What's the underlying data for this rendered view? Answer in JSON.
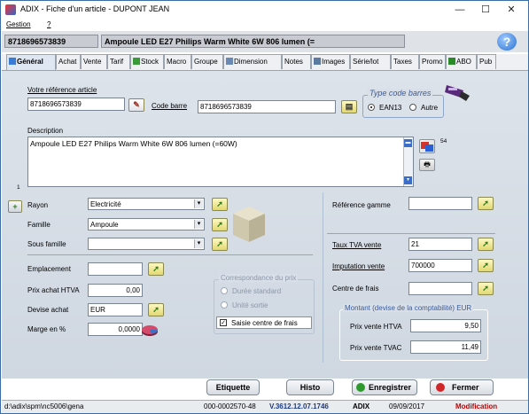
{
  "window": {
    "title": "ADIX - Fiche d'un article - DUPONT JEAN"
  },
  "menu": {
    "items": [
      "Gestion",
      "?"
    ]
  },
  "header": {
    "code": "8718696573839",
    "name": "Ampoule LED E27 Philips Warm White 6W 806 lumen (="
  },
  "tabs": [
    "Général",
    "Achat",
    "Vente",
    "Tarif",
    "Stock",
    "Macro",
    "Groupe",
    "Dimension",
    "Notes",
    "Images",
    "Série/lot",
    "Taxes",
    "Promo",
    "ABO",
    "Pub"
  ],
  "form": {
    "ref_label": "Votre référence article",
    "ref_value": "8718696573839",
    "barcode_label": "Code barre",
    "barcode_value": "8718696573839",
    "barcode_type_title": "Type code barres",
    "ean13_label": "EAN13",
    "autre_label": "Autre",
    "description_label": "Description",
    "description_value": "Ampoule LED E27 Philips Warm White 6W 806 lumen (=60W)",
    "description_count": "54",
    "side_num": "1",
    "rayon_label": "Rayon",
    "rayon_value": "Electricité",
    "famille_label": "Famille",
    "famille_value": "Ampoule",
    "sousfamille_label": "Sous famille",
    "sousfamille_value": "",
    "refgamme_label": "Référence gamme",
    "refgamme_value": "",
    "tva_label": "Taux TVA vente",
    "tva_value": "21",
    "imputation_label": "Imputation vente",
    "imputation_value": "700000",
    "centrefrais_label": "Centre de frais",
    "centrefrais_value": "",
    "emplacement_label": "Emplacement",
    "emplacement_value": "",
    "prixachat_label": "Prix achat HTVA",
    "prixachat_value": "0,00",
    "devise_label": "Devise achat",
    "devise_value": "EUR",
    "marge_label": "Marge en %",
    "marge_value": "0,0000",
    "corresp_title": "Correspondance du prix",
    "duree_label": "Durée standard",
    "unite_label": "Unité sortie",
    "saisie_label": "Saisie centre de frais",
    "montant_title": "Montant (devise de la comptabilité) EUR",
    "prixvente_htva_label": "Prix vente HTVA",
    "prixvente_htva_value": "9,50",
    "prixvente_tvac_label": "Prix vente TVAC",
    "prixvente_tvac_value": "11,49"
  },
  "buttons": {
    "etiquette": "Etiquette",
    "histo": "Histo",
    "enregistrer": "Enregistrer",
    "fermer": "Fermer"
  },
  "status": {
    "path": "d:\\adix\\spm\\nc5006\\gena",
    "code": "000-0002570-48",
    "version": "V.3612.12.07.1746",
    "app": "ADIX",
    "date": "09/09/2017",
    "mode": "Modification"
  },
  "colors": {
    "mode": "#c00000",
    "version": "#1a3a8a"
  }
}
